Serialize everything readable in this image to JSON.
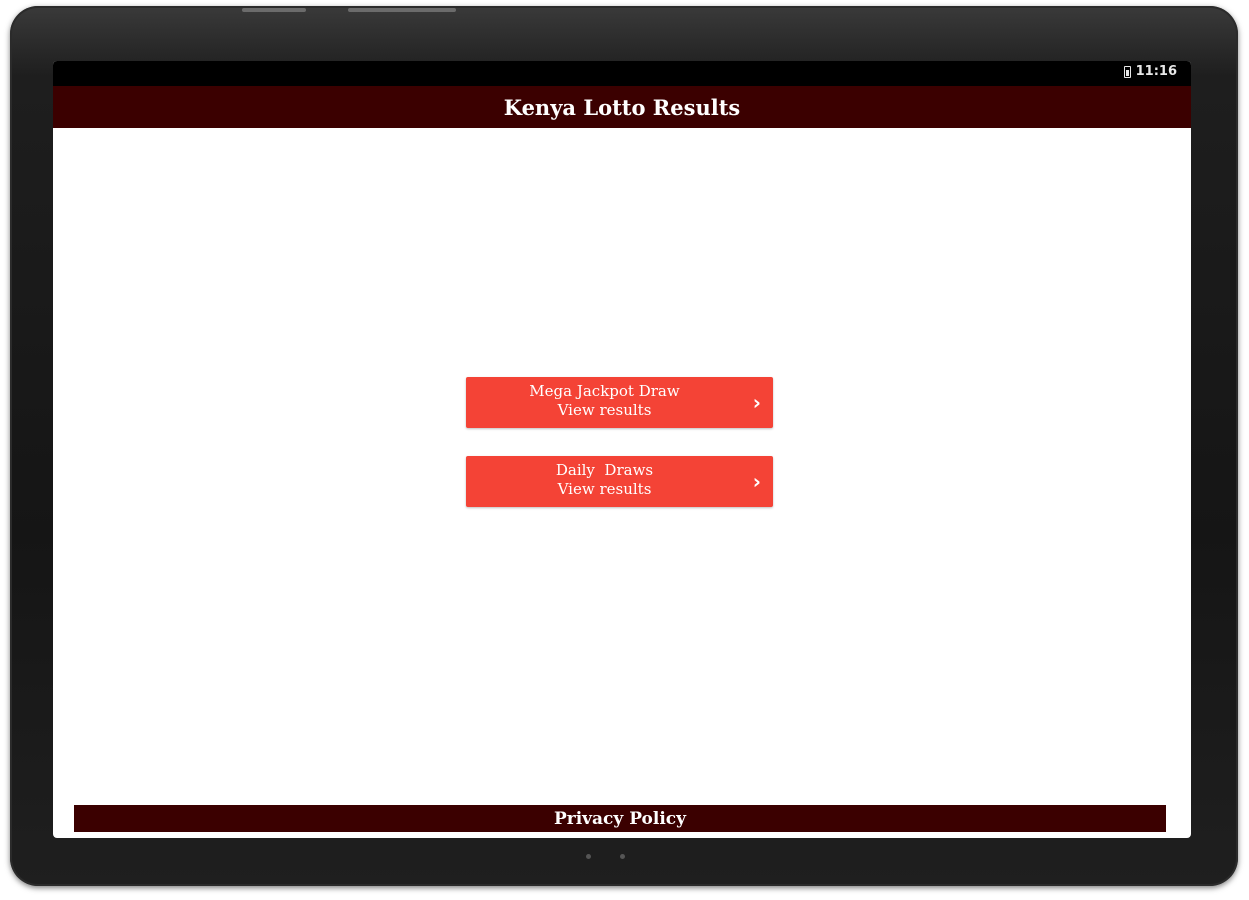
{
  "status_bar": {
    "time": "11:16"
  },
  "app_bar": {
    "title": "Kenya Lotto Results"
  },
  "buttons": [
    {
      "line1": "Mega Jackpot Draw",
      "line2": "View results"
    },
    {
      "line1": "Daily  Draws",
      "line2": "View results"
    }
  ],
  "footer": {
    "label": "Privacy Policy"
  },
  "colors": {
    "app_bar": "#3b0000",
    "button": "#f44336"
  }
}
